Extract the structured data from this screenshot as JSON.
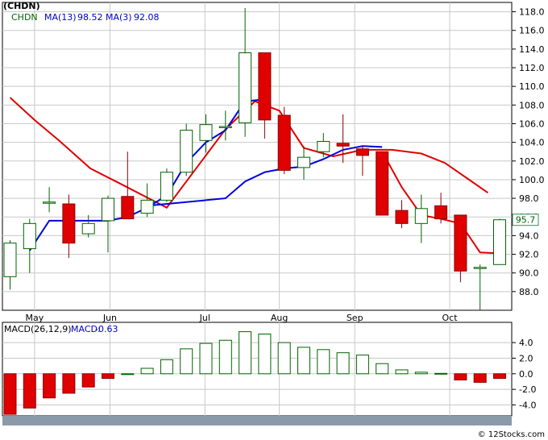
{
  "chart_data": [
    {
      "type": "candlestick",
      "title": "(CHDN)",
      "legend": [
        {
          "label": "CHDN",
          "color": "#006400",
          "value": ""
        },
        {
          "label": "MA(13)",
          "color": "#0000cc",
          "value": "98.52"
        },
        {
          "label": "MA(3)",
          "color": "#0000cc",
          "value": "92.08"
        }
      ],
      "last_price_label": "95.7",
      "ylim": [
        86,
        119
      ],
      "y_ticks": [
        88,
        90,
        92,
        94,
        96,
        98,
        100,
        102,
        104,
        106,
        108,
        110,
        112,
        114,
        116,
        118
      ],
      "y_tick_labels": [
        "88.0",
        "90.0",
        "92.0",
        "94.0",
        "96.0",
        "98.0",
        "100.0",
        "102.0",
        "104.0",
        "106.0",
        "108.0",
        "110.0",
        "112.0",
        "114.0",
        "116.0",
        "118.0"
      ],
      "x_months": [
        {
          "label": "May",
          "index": 1.25
        },
        {
          "label": "Jun",
          "index": 5.1
        },
        {
          "label": "Jul",
          "index": 9.95
        },
        {
          "label": "Aug",
          "index": 13.75
        },
        {
          "label": "Sep",
          "index": 17.6
        },
        {
          "label": "Oct",
          "index": 22.45
        }
      ],
      "candles": [
        {
          "o": 89.6,
          "h": 93.5,
          "l": 88.2,
          "c": 93.2
        },
        {
          "o": 92.6,
          "h": 95.8,
          "l": 90.0,
          "c": 95.3
        },
        {
          "o": 97.6,
          "h": 99.2,
          "l": 96.5,
          "c": 97.6
        },
        {
          "o": 97.4,
          "h": 98.4,
          "l": 91.6,
          "c": 93.2
        },
        {
          "o": 94.2,
          "h": 96.2,
          "l": 93.8,
          "c": 95.3
        },
        {
          "o": 95.6,
          "h": 98.3,
          "l": 92.2,
          "c": 98.0
        },
        {
          "o": 98.2,
          "h": 103.0,
          "l": 95.8,
          "c": 95.8
        },
        {
          "o": 96.4,
          "h": 99.6,
          "l": 96.0,
          "c": 97.8
        },
        {
          "o": 97.8,
          "h": 101.2,
          "l": 97.6,
          "c": 100.8
        },
        {
          "o": 100.8,
          "h": 106.0,
          "l": 100.4,
          "c": 105.3
        },
        {
          "o": 104.2,
          "h": 107.0,
          "l": 102.9,
          "c": 105.9
        },
        {
          "o": 105.7,
          "h": 107.4,
          "l": 104.2,
          "c": 105.7
        },
        {
          "o": 106.1,
          "h": 118.4,
          "l": 104.6,
          "c": 113.6
        },
        {
          "o": 113.6,
          "h": 113.6,
          "l": 104.4,
          "c": 106.4
        },
        {
          "o": 106.9,
          "h": 107.8,
          "l": 100.6,
          "c": 101.0
        },
        {
          "o": 101.3,
          "h": 103.6,
          "l": 100.0,
          "c": 102.4
        },
        {
          "o": 103.0,
          "h": 105.0,
          "l": 102.4,
          "c": 104.1
        },
        {
          "o": 103.9,
          "h": 107.0,
          "l": 101.8,
          "c": 103.6
        },
        {
          "o": 103.3,
          "h": 103.6,
          "l": 100.4,
          "c": 102.6
        },
        {
          "o": 103.0,
          "h": 103.0,
          "l": 96.2,
          "c": 96.2
        },
        {
          "o": 96.7,
          "h": 97.8,
          "l": 94.8,
          "c": 95.3
        },
        {
          "o": 95.3,
          "h": 98.4,
          "l": 93.2,
          "c": 96.9
        },
        {
          "o": 97.2,
          "h": 98.6,
          "l": 95.3,
          "c": 95.8
        },
        {
          "o": 96.2,
          "h": 96.2,
          "l": 89.0,
          "c": 90.2
        },
        {
          "o": 90.6,
          "h": 90.9,
          "l": 86.0,
          "c": 90.6
        },
        {
          "o": 90.9,
          "h": 95.8,
          "l": 90.9,
          "c": 95.7
        }
      ],
      "ma_red": [
        {
          "i": 0,
          "v": 108.8
        },
        {
          "i": 1.25,
          "v": 106.4
        },
        {
          "i": 2.5,
          "v": 104.2
        },
        {
          "i": 4.1,
          "v": 101.2
        },
        {
          "i": 5.6,
          "v": 99.6
        },
        {
          "i": 8.0,
          "v": 97.0
        },
        {
          "i": 11.0,
          "v": 105.4
        },
        {
          "i": 12.5,
          "v": 108.4
        },
        {
          "i": 13.75,
          "v": 107.4
        },
        {
          "i": 15.0,
          "v": 103.4
        },
        {
          "i": 16.5,
          "v": 102.5
        },
        {
          "i": 18.0,
          "v": 103.2
        },
        {
          "i": 19.5,
          "v": 103.2
        },
        {
          "i": 21.0,
          "v": 102.8
        },
        {
          "i": 22.2,
          "v": 101.8
        },
        {
          "i": 23.3,
          "v": 100.2
        },
        {
          "i": 24.4,
          "v": 98.6
        }
      ],
      "ma_red2": [
        {
          "i": 19.0,
          "v": 103.0
        },
        {
          "i": 20.0,
          "v": 99.2
        },
        {
          "i": 21.0,
          "v": 96.2
        },
        {
          "i": 22.0,
          "v": 95.8
        },
        {
          "i": 23.0,
          "v": 95.3
        },
        {
          "i": 24.0,
          "v": 92.2
        },
        {
          "i": 25.0,
          "v": 92.1
        }
      ],
      "ma_blue": [
        {
          "i": 1.0,
          "v": 92.4
        },
        {
          "i": 2.0,
          "v": 95.6
        },
        {
          "i": 3.0,
          "v": 95.6
        },
        {
          "i": 4.0,
          "v": 95.6
        },
        {
          "i": 5.0,
          "v": 95.6
        },
        {
          "i": 6.0,
          "v": 96.0
        },
        {
          "i": 7.0,
          "v": 97.0
        },
        {
          "i": 8.0,
          "v": 98.3
        },
        {
          "i": 9.0,
          "v": 101.8
        },
        {
          "i": 10.0,
          "v": 104.0
        },
        {
          "i": 11.0,
          "v": 105.3
        },
        {
          "i": 12.0,
          "v": 108.4
        },
        {
          "i": 13.0,
          "v": 108.6
        }
      ],
      "ma_blue2": [
        {
          "i": 7.0,
          "v": 97.2
        },
        {
          "i": 11.0,
          "v": 98.0
        },
        {
          "i": 12.0,
          "v": 99.8
        },
        {
          "i": 13.0,
          "v": 100.8
        },
        {
          "i": 14.0,
          "v": 101.2
        },
        {
          "i": 15.0,
          "v": 101.4
        },
        {
          "i": 16.0,
          "v": 102.2
        },
        {
          "i": 17.0,
          "v": 103.2
        },
        {
          "i": 18.0,
          "v": 103.6
        },
        {
          "i": 19.0,
          "v": 103.5
        }
      ]
    },
    {
      "type": "bar",
      "title": "MACD(26,12,9)",
      "legend": [
        {
          "label": "MACD(26,12,9)",
          "color": "#000000",
          "value": ""
        },
        {
          "label": "MACD:",
          "color": "#0000cc",
          "value": "-0.63"
        }
      ],
      "ylim": [
        -5.4,
        6.6
      ],
      "y_ticks": [
        4,
        2,
        0,
        -2,
        -4
      ],
      "y_tick_labels": [
        "4.0",
        "2.0",
        "0.0",
        "-2.0",
        "-4.0"
      ],
      "values": [
        -5.2,
        -4.4,
        -3.1,
        -2.5,
        -1.7,
        -0.6,
        0.0,
        0.7,
        1.8,
        3.2,
        3.9,
        4.3,
        5.4,
        5.1,
        4.0,
        3.4,
        3.1,
        2.7,
        2.4,
        1.3,
        0.5,
        0.2,
        0.05,
        -0.8,
        -1.1,
        -0.6
      ]
    }
  ],
  "watermark": "© 12Stocks.com"
}
